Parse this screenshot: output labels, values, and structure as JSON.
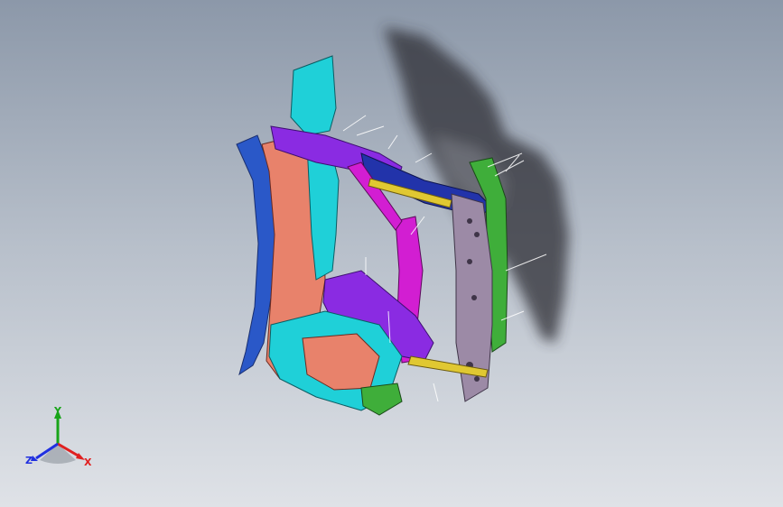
{
  "viewport": {
    "background_top": "#8c98a9",
    "background_bottom": "#dfe2e7"
  },
  "model": {
    "colors": {
      "cyan": "#1fd0d8",
      "salmon": "#e8826b",
      "purple": "#8a2be2",
      "magenta": "#d21ed2",
      "blue": "#2a58c8",
      "navy": "#2233aa",
      "mauve": "#9c8aa6",
      "green": "#3fae3a",
      "yellow": "#e0c832",
      "shadow": "#2e2e34"
    }
  },
  "triad": {
    "x_label": "X",
    "y_label": "Y",
    "z_label": "Z",
    "x_color": "#e02020",
    "y_color": "#18a418",
    "z_color": "#2030e0"
  }
}
